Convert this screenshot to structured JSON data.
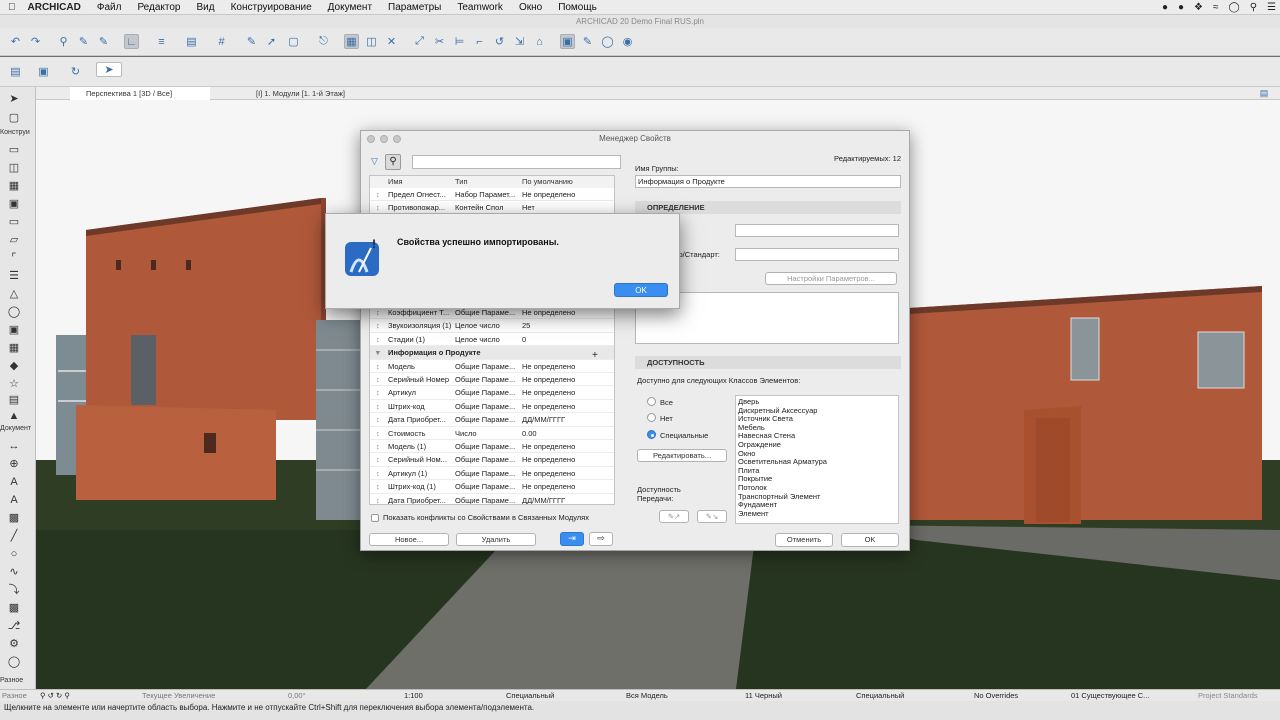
{
  "menubar": {
    "app": "ARCHICAD",
    "items": [
      "Файл",
      "Редактор",
      "Вид",
      "Конструирование",
      "Документ",
      "Параметры",
      "Teamwork",
      "Окно",
      "Помощь"
    ]
  },
  "window_title": "ARCHICAD 20 Demo Final RUS.pln",
  "tabs": [
    "Перспектива 1 [3D / Все]",
    "[I] 1. Модули [1. 1-й Этаж]"
  ],
  "toolbox": {
    "label_construct": "Конструи",
    "label_doc": "Документ",
    "label_other": "Разное"
  },
  "pm": {
    "title": "Менеджер Свойств",
    "editable": "Редактируемых: 12",
    "columns": [
      "Имя",
      "Тип",
      "По умолчанию"
    ],
    "rows_top": [
      {
        "name": "Предел Огнест...",
        "type": "Набор Парамет...",
        "def": "Не определено"
      },
      {
        "name": "Противопожар...",
        "type": "Контейн Спол",
        "def": "Нет"
      }
    ],
    "rows": [
      {
        "name": "Коэффициент Т...",
        "type": "Общие Параме...",
        "def": "Не определено"
      },
      {
        "name": "Звукоизоляция (1)",
        "type": "Целое число",
        "def": "25"
      },
      {
        "name": "Стадии (1)",
        "type": "Целое число",
        "def": "0"
      },
      {
        "group": "Информация о Продукте"
      },
      {
        "name": "Модель",
        "type": "Общие Параме...",
        "def": "Не определено"
      },
      {
        "name": "Серийный Номер",
        "type": "Общие Параме...",
        "def": "Не определено"
      },
      {
        "name": "Артикул",
        "type": "Общие Параме...",
        "def": "Не определено"
      },
      {
        "name": "Штрих-код",
        "type": "Общие Параме...",
        "def": "Не определено"
      },
      {
        "name": "Дата Приобрет...",
        "type": "Общие Параме...",
        "def": "ДД/ММ/ГГГГ"
      },
      {
        "name": "Стоимость",
        "type": "Число",
        "def": "0.00"
      },
      {
        "name": "Модель (1)",
        "type": "Общие Параме...",
        "def": "Не определено"
      },
      {
        "name": "Серийный Ном...",
        "type": "Общие Параме...",
        "def": "Не определено"
      },
      {
        "name": "Артикул (1)",
        "type": "Общие Параме...",
        "def": "Не определено"
      },
      {
        "name": "Штрих-код (1)",
        "type": "Общие Параме...",
        "def": "Не определено"
      },
      {
        "name": "Дата Приобрет...",
        "type": "Общие Параме...",
        "def": "ДД/ММ/ГГГГ"
      }
    ],
    "conflict_label": "Показать конфликты со Свойствами в Связанных Модулях",
    "new_btn": "Новое...",
    "delete_btn": "Удалить",
    "group_name_label": "Имя Группы:",
    "group_name_value": "Информация о Продукте",
    "definition": "ОПРЕДЕЛЕНИЕ",
    "standard_label": "отр/Стандарт:",
    "params_btn": "Настройки Параметров...",
    "availability": "ДОСТУПНОСТЬ",
    "avail_for": "Доступно для следующих Классов Элементов:",
    "radio_all": "Все",
    "radio_none": "Нет",
    "radio_special": "Специальные",
    "edit_btn": "Редактировать...",
    "transfer_label": "Доступность Передачи:",
    "classes": [
      "Дверь",
      "Дискретный Аксессуар",
      "Источник Света",
      "Мебель",
      "Навесная Стена",
      "Ограждение",
      "Окно",
      "Осветительная Арматура",
      "Плита",
      "Покрытие",
      "Потолок",
      "Транспортный Элемент",
      "Фундамент",
      "Элемент"
    ],
    "cancel_btn": "Отменить",
    "ok_btn": "OK"
  },
  "alert": {
    "message": "Свойства успешно импортированы.",
    "ok": "OK"
  },
  "status": {
    "zoom_label": "Текущее Увеличение",
    "angle": "0,00°",
    "scale": "1:100",
    "layer_combo": "Специальный",
    "model": "Вся Модель",
    "pen": "11 Черный",
    "mvo": "Специальный",
    "override": "No Overrides",
    "reno": "01 Существующее С...",
    "standards": "Project Standards"
  },
  "hint": "Щелкните на элементе или начертите область выбора. Нажмите и не отпускайте Ctrl+Shift для переключения выбора элемента/подэлемента.",
  "colors": {
    "accent": "#3a8ef0",
    "brick": "#b0583a",
    "grass": "#2a3a20"
  }
}
